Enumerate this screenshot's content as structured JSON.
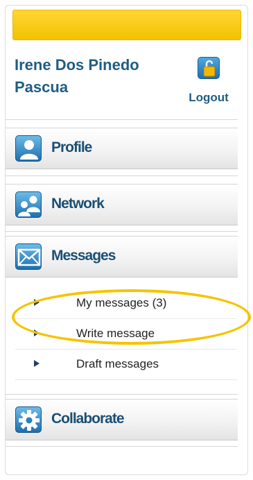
{
  "user": {
    "name": "Irene Dos Pinedo Pascua",
    "logout_label": "Logout"
  },
  "nav": {
    "items": [
      {
        "label": "Profile",
        "icon": "profile-icon"
      },
      {
        "label": "Network",
        "icon": "network-icon"
      },
      {
        "label": "Messages",
        "icon": "envelope-icon"
      },
      {
        "label": "Collaborate",
        "icon": "gear-icon"
      }
    ],
    "messages_submenu": [
      {
        "label": "My messages (3)"
      },
      {
        "label": "Write message"
      },
      {
        "label": "Draft messages"
      }
    ]
  },
  "colors": {
    "accent_yellow": "#f5c400",
    "nav_blue": "#1e6fae",
    "text_blue": "#1f5d84"
  }
}
